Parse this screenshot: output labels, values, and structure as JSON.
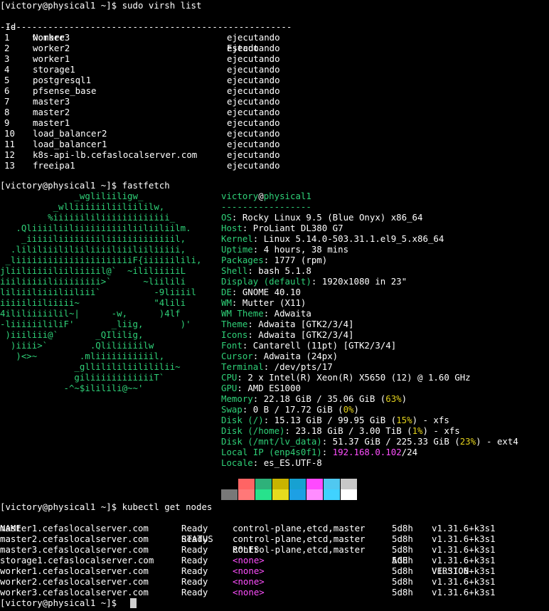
{
  "virsh": {
    "prompt": "[victory@physical1 ~]$ sudo virsh list",
    "header": {
      "id": " Id",
      "name": "Nombre",
      "state": "Estado"
    },
    "separator": "-------------------------------------------------------",
    "rows": [
      {
        "id": "1",
        "name": "worker3",
        "state": "ejecutando"
      },
      {
        "id": "2",
        "name": "worker2",
        "state": "ejecutando"
      },
      {
        "id": "3",
        "name": "worker1",
        "state": "ejecutando"
      },
      {
        "id": "4",
        "name": "storage1",
        "state": "ejecutando"
      },
      {
        "id": "5",
        "name": "postgresql1",
        "state": "ejecutando"
      },
      {
        "id": "6",
        "name": "pfsense_base",
        "state": "ejecutando"
      },
      {
        "id": "7",
        "name": "master3",
        "state": "ejecutando"
      },
      {
        "id": "8",
        "name": "master2",
        "state": "ejecutando"
      },
      {
        "id": "9",
        "name": "master1",
        "state": "ejecutando"
      },
      {
        "id": "10",
        "name": "load_balancer2",
        "state": "ejecutando"
      },
      {
        "id": "11",
        "name": "load_balancer1",
        "state": "ejecutando"
      },
      {
        "id": "12",
        "name": "k8s-api-lb.cefaslocalserver.com",
        "state": "ejecutando"
      },
      {
        "id": "13",
        "name": "freeipa1",
        "state": "ejecutando"
      }
    ]
  },
  "fastfetch": {
    "prompt": "[victory@physical1 ~]$ fastfetch",
    "logo": [
      "              _wgliliiligw_",
      "          _wlliiiiiiliiliililw,",
      "         %iiiiiililiiiiiiiiiiiii_",
      "   .Qliiiiliiliiiiiiiiiiliiliiliilm.",
      "    _iiiiiliiiiiiiiliiiiiiiiiiiiil,",
      "  .lililiiililiiliiiiliiiliiliiiii,",
      " _liiiiiiiiiiiiiiiiiiiiiiF{iiiiiilili,",
      "jliiliiiiiliiliiiiil@`  ~ililiiiiiL",
      "iiiliiiiiliiiiiiiii>`      ~liilili",
      "liliiiliiiiliiliii`          -9liiiil",
      "iiiiiliiliiiii~              \"4lili",
      "4ililiiiiilil~|      -w,      )4lf",
      "-liiiiiililiF'       _liig,       )'",
      " )iiiliii@`       _QIlilig,",
      "  )iiii>`        .Qliliiiiilw",
      "   )<>~        .mliiiiiiiiiiil,",
      "              _gllilililiilililii~",
      "              giliiiiiiiiiiiiT`",
      "            -^~$ililili@~~'"
    ],
    "user": "victory",
    "at": "@",
    "host": "physical1",
    "underline": "-----------------",
    "info": [
      {
        "key": "OS",
        "value": "Rocky Linux 9.5 (Blue Onyx) x86_64"
      },
      {
        "key": "Host",
        "value": "ProLiant DL380 G7"
      },
      {
        "key": "Kernel",
        "value": "Linux 5.14.0-503.31.1.el9_5.x86_64"
      },
      {
        "key": "Uptime",
        "value": "4 hours, 38 mins"
      },
      {
        "key": "Packages",
        "value": "1777 (rpm)"
      },
      {
        "key": "Shell",
        "value": "bash 5.1.8"
      },
      {
        "key": "Display (default)",
        "value": "1920x1080 in 23\""
      },
      {
        "key": "DE",
        "value": "GNOME 40.10"
      },
      {
        "key": "WM",
        "value": "Mutter (X11)"
      },
      {
        "key": "WM Theme",
        "value": "Adwaita"
      },
      {
        "key": "Theme",
        "value": "Adwaita [GTK2/3/4]"
      },
      {
        "key": "Icons",
        "value": "Adwaita [GTK2/3/4]"
      },
      {
        "key": "Font",
        "value": "Cantarell (11pt) [GTK2/3/4]"
      },
      {
        "key": "Cursor",
        "value": "Adwaita (24px)"
      },
      {
        "key": "Terminal",
        "value": "/dev/pts/17"
      },
      {
        "key": "CPU",
        "value": "2 x Intel(R) Xeon(R) X5650 (12) @ 1.60 GHz"
      },
      {
        "key": "GPU",
        "value": "AMD ES1000"
      },
      {
        "key": "Memory",
        "value": "22.18 GiB / 35.06 GiB (",
        "pct": "63%",
        "tail": ")"
      },
      {
        "key": "Swap",
        "value": "0 B / 17.72 GiB (",
        "pct": "0%",
        "tail": ")"
      },
      {
        "key": "Disk (/)",
        "value": "15.13 GiB / 99.95 GiB (",
        "pct": "15%",
        "tail": ") - xfs"
      },
      {
        "key": "Disk (/home)",
        "value": "23.18 GiB / 3.00 TiB (",
        "pct": "1%",
        "tail": ") - xfs"
      },
      {
        "key": "Disk (/mnt/lv_data)",
        "value": "51.37 GiB / 225.33 GiB (",
        "pct": "23%",
        "tail": ") - ext4"
      },
      {
        "key": "Local IP (enp4s0f1)",
        "ip": "192.168.0.102",
        "tail": "/24"
      },
      {
        "key": "Locale",
        "value": "es_ES.UTF-8"
      }
    ],
    "palette_top": [
      "#000000",
      "#ff6464",
      "#2eb17a",
      "#c8b400",
      "#17a1d1",
      "#ff49ff",
      "#50c8f0",
      "#c8c8c8"
    ],
    "palette_bottom": [
      "#787878",
      "#ff7878",
      "#27e28c",
      "#e6dc1e",
      "#1da0e4",
      "#ff8cff",
      "#40d2ff",
      "#ffffff"
    ]
  },
  "kubectl": {
    "prompt": "[victory@physical1 ~]$ kubectl get nodes",
    "headers": [
      "NAME",
      "STATUS",
      "ROLES",
      "AGE",
      "VERSION"
    ],
    "rows": [
      {
        "name": "master1.cefaslocalserver.com",
        "status": "Ready",
        "roles": "control-plane,etcd,master",
        "age": "5d8h",
        "version": "v1.31.6+k3s1"
      },
      {
        "name": "master2.cefaslocalserver.com",
        "status": "Ready",
        "roles": "control-plane,etcd,master",
        "age": "5d8h",
        "version": "v1.31.6+k3s1"
      },
      {
        "name": "master3.cefaslocalserver.com",
        "status": "Ready",
        "roles": "control-plane,etcd,master",
        "age": "5d8h",
        "version": "v1.31.6+k3s1"
      },
      {
        "name": "storage1.cefaslocalserver.com",
        "status": "Ready",
        "roles": "<none>",
        "age": "5d8h",
        "version": "v1.31.6+k3s1"
      },
      {
        "name": "worker1.cefaslocalserver.com",
        "status": "Ready",
        "roles": "<none>",
        "age": "5d8h",
        "version": "v1.31.6+k3s1"
      },
      {
        "name": "worker2.cefaslocalserver.com",
        "status": "Ready",
        "roles": "<none>",
        "age": "5d8h",
        "version": "v1.31.6+k3s1"
      },
      {
        "name": "worker3.cefaslocalserver.com",
        "status": "Ready",
        "roles": "<none>",
        "age": "5d8h",
        "version": "v1.31.6+k3s1"
      }
    ]
  },
  "final_prompt": "[victory@physical1 ~]$ "
}
